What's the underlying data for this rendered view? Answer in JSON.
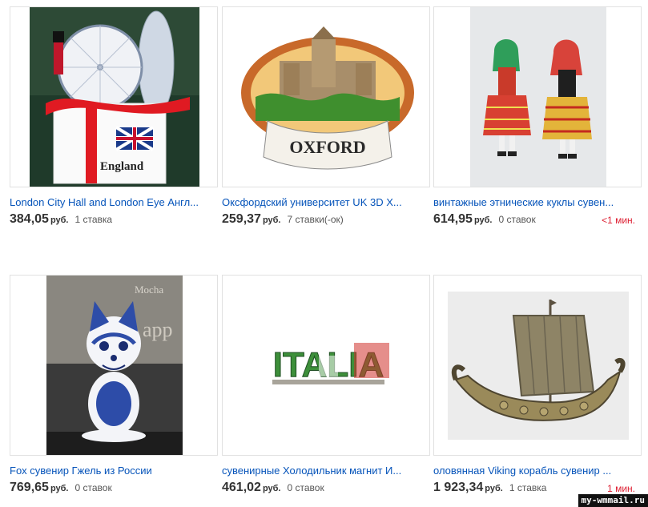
{
  "items": [
    {
      "title": "London City Hall and London Eye Англ...",
      "price": "384,05",
      "currency": "руб.",
      "bids": "1 ставка",
      "time": "",
      "image": "england-souvenir-magnet",
      "image_text": "England"
    },
    {
      "title": "Оксфордский университет UK 3D X...",
      "price": "259,37",
      "currency": "руб.",
      "bids": "7 ставки(-ок)",
      "time": "",
      "image": "oxford-magnet",
      "image_text": "OXFORD"
    },
    {
      "title": "винтажные этнические куклы сувен...",
      "price": "614,95",
      "currency": "руб.",
      "bids": "0 ставок",
      "time": "<1 мин.",
      "image": "ethnic-dolls"
    },
    {
      "title": "Fox сувенир Гжель из России",
      "price": "769,65",
      "currency": "руб.",
      "bids": "0 ставок",
      "time": "",
      "image": "gzhel-fox-figurine",
      "image_text": "Mocha"
    },
    {
      "title": "сувенирные Холодильник магнит И...",
      "price": "461,02",
      "currency": "руб.",
      "bids": "0 ставок",
      "time": "",
      "image": "italia-magnet",
      "image_text": "ITALIA"
    },
    {
      "title": "оловянная Viking корабль сувенир ...",
      "price": "1 923,34",
      "currency": "руб.",
      "bids": "1 ставка",
      "time": "1 мин.",
      "image": "viking-ship"
    }
  ],
  "watermark": "my-wmmail.ru",
  "colors": {
    "link": "#0654ba",
    "price": "#333333",
    "time_urgent": "#dd1e31"
  }
}
